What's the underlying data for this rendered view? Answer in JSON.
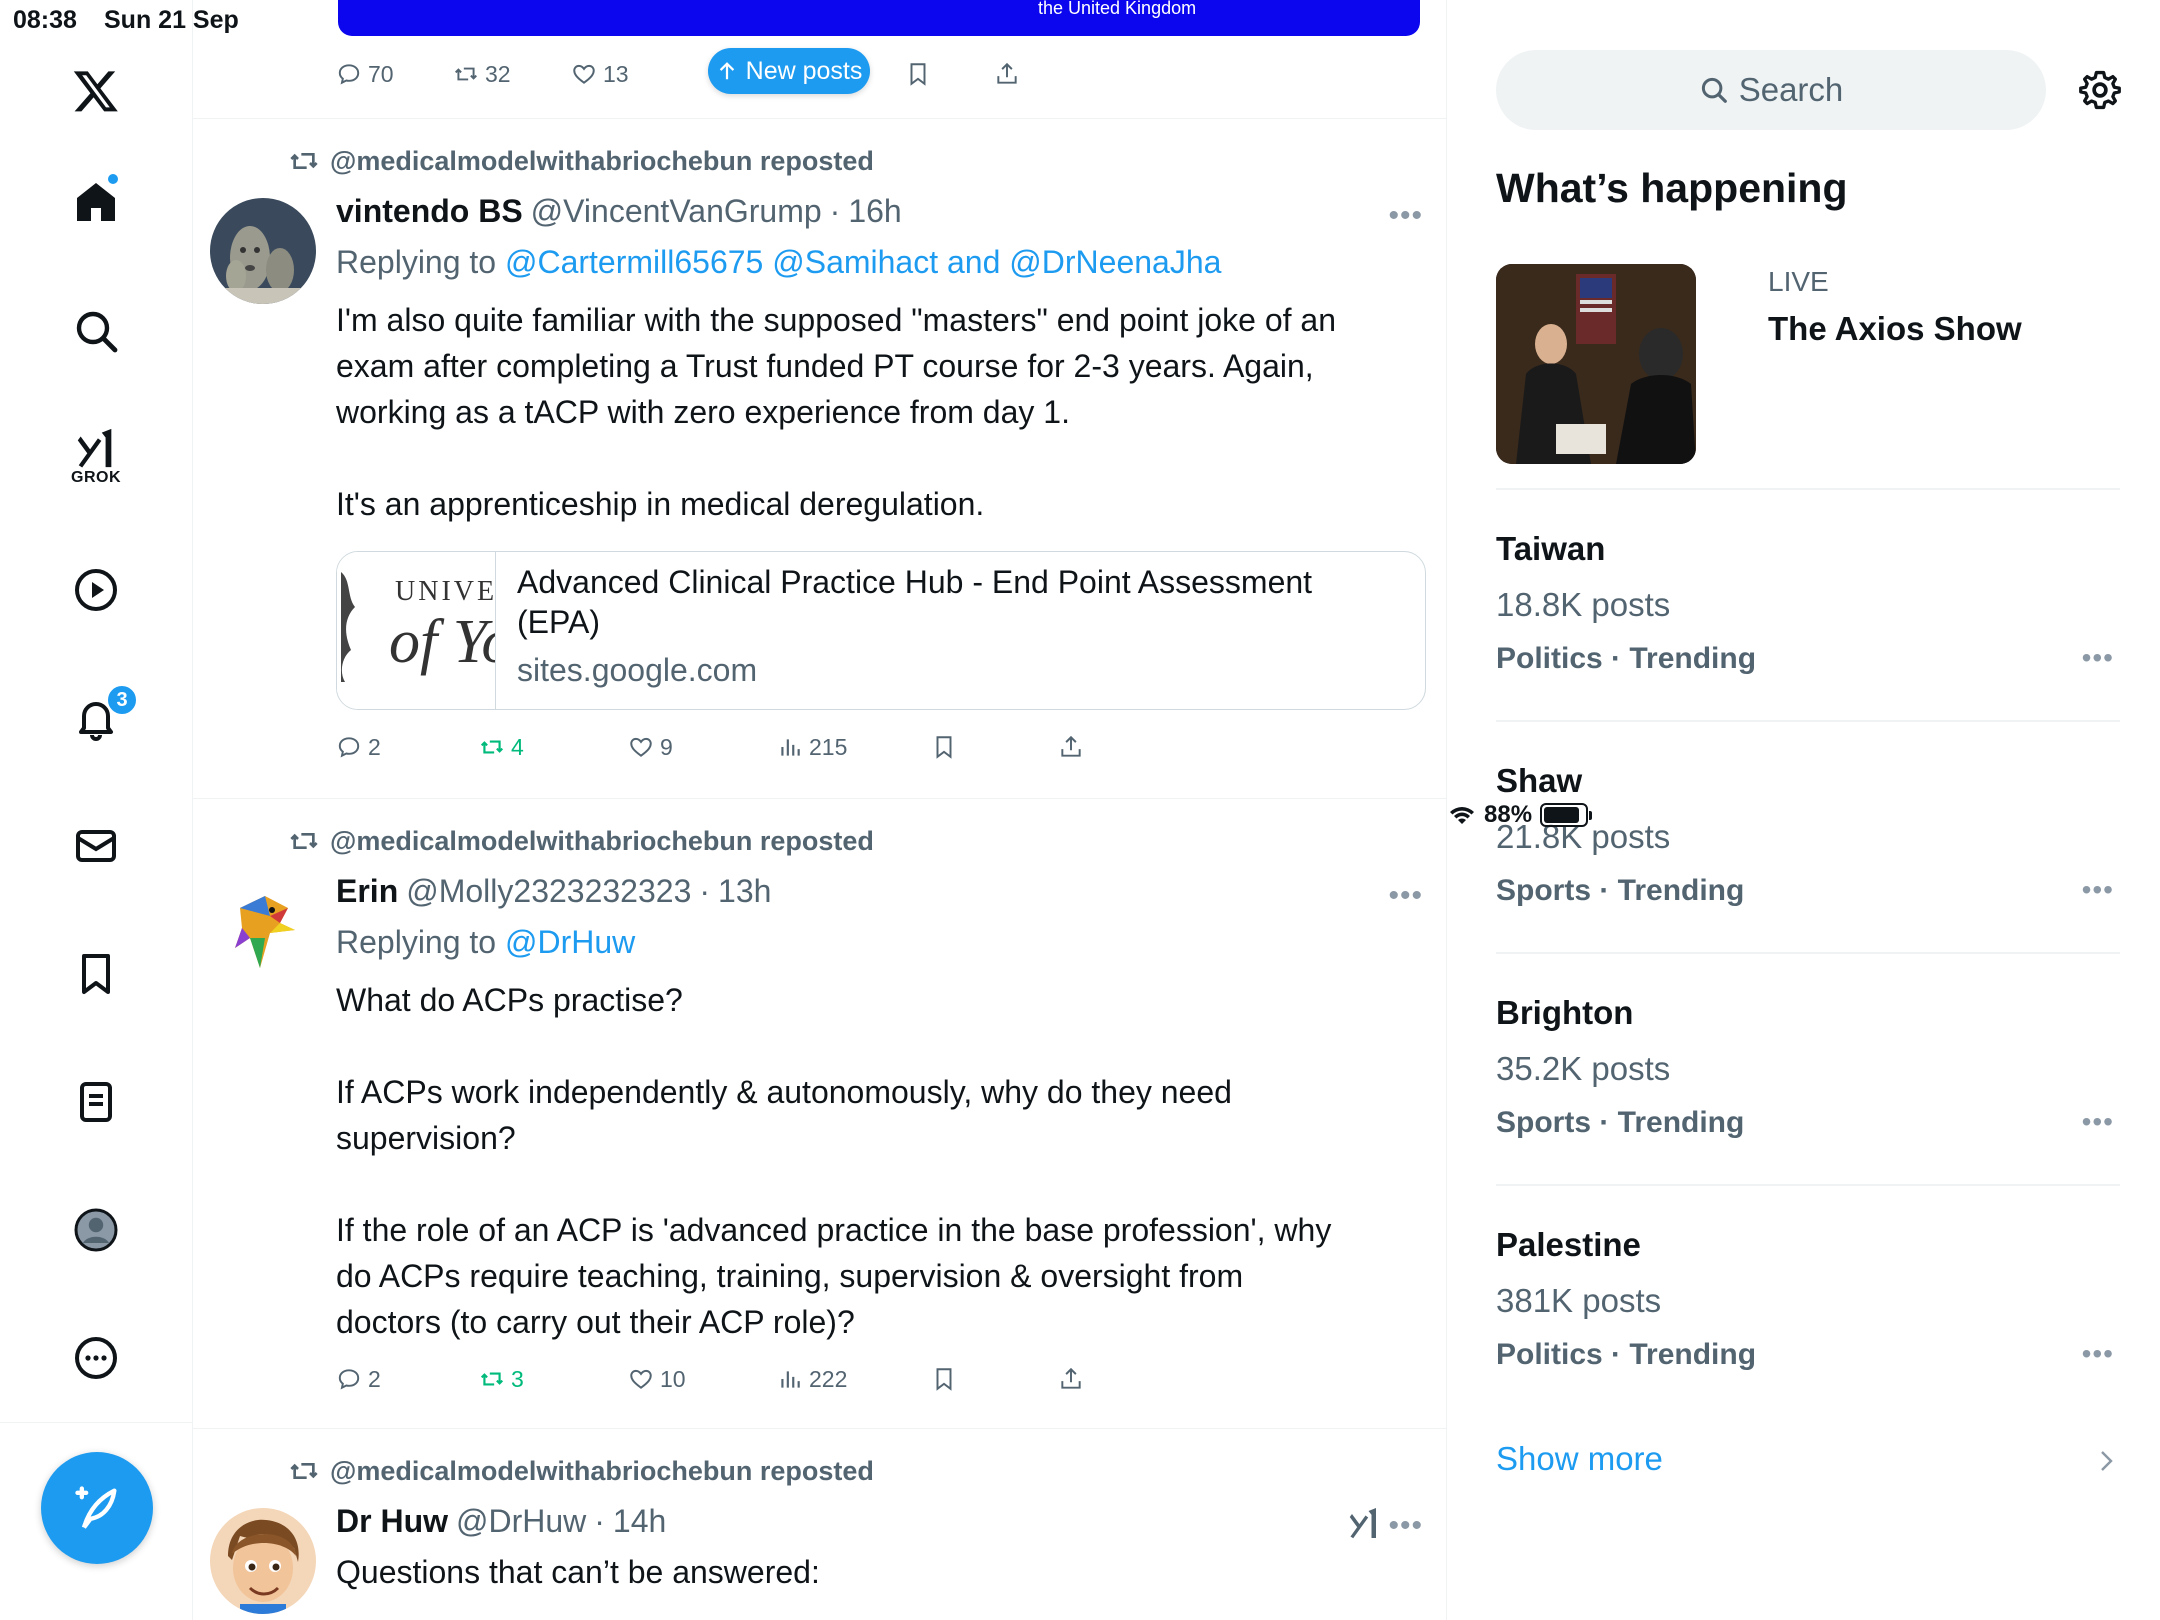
{
  "status": {
    "time": "08:38",
    "date": "Sun 21 Sep",
    "battery": "88%",
    "battery_level": 0.88
  },
  "nav": {
    "grok_label": "GROK",
    "notifications_count": "3"
  },
  "top_banner": {
    "text": "the United Kingdom"
  },
  "top_actions": {
    "replies": "70",
    "reposts": "32",
    "likes": "13",
    "views": ""
  },
  "new_posts": {
    "label": "New posts"
  },
  "posts": [
    {
      "reposted_by": "@medicalmodelwithabriochebun reposted",
      "name": "vintendo BS",
      "handle": "@VincentVanGrump",
      "time": "16h",
      "reply_prefix": "Replying to",
      "reply_to": "@Cartermill65675 @Samihact and @DrNeenaJha",
      "paragraphs": [
        "I'm also quite familiar with the supposed \"masters\" end point joke of an exam after completing a Trust funded PT course for 2-3 years. Again, working as a tACP with zero experience from day 1.",
        "It's an apprenticeship in medical deregulation."
      ],
      "card": {
        "logo_text_1": "UNIVER",
        "logo_text_2": "of Yo",
        "title": "Advanced Clinical Practice Hub - End Point Assessment (EPA)",
        "domain": "sites.google.com"
      },
      "replies": "2",
      "reposts": "4",
      "likes": "9",
      "views": "215"
    },
    {
      "reposted_by": "@medicalmodelwithabriochebun reposted",
      "name": "Erin",
      "handle": "@Molly2323232323",
      "time": "13h",
      "reply_prefix": "Replying to",
      "reply_to": "@DrHuw",
      "paragraphs": [
        "What do ACPs practise?",
        "If ACPs work independently & autonomously, why do they need supervision?",
        "If the role of an ACP is 'advanced practice in the base profession', why do ACPs require teaching, training, supervision & oversight from doctors (to carry out their ACP role)?"
      ],
      "replies": "2",
      "reposts": "3",
      "likes": "10",
      "views": "222"
    },
    {
      "reposted_by": "@medicalmodelwithabriochebun reposted",
      "name": "Dr Huw",
      "handle": "@DrHuw",
      "time": "14h",
      "paragraphs": [
        "Questions that can’t be answered:"
      ]
    }
  ],
  "sidebar": {
    "search_placeholder": "Search",
    "heading": "What’s happening",
    "live": {
      "label": "LIVE",
      "title": "The Axios Show"
    },
    "trends": [
      {
        "name": "Taiwan",
        "count": "18.8K posts",
        "category": "Politics · Trending"
      },
      {
        "name": "Shaw",
        "count": "21.8K posts",
        "category": "Sports · Trending"
      },
      {
        "name": "Brighton",
        "count": "35.2K posts",
        "category": "Sports · Trending"
      },
      {
        "name": "Palestine",
        "count": "381K posts",
        "category": "Politics · Trending"
      }
    ],
    "show_more": "Show more"
  },
  "colors": {
    "accent": "#1d9bf0",
    "text": "#0f1419",
    "muted": "#536471",
    "repost_green": "#00ba7c",
    "banner_blue": "#0b06ee"
  },
  "icons": [
    "x-logo-icon",
    "home-icon",
    "search-icon",
    "grok-icon",
    "video-icon",
    "bell-icon",
    "mail-icon",
    "bookmark-icon",
    "list-icon",
    "profile-icon",
    "more-icon",
    "compose-icon",
    "reply-icon",
    "repost-icon",
    "like-icon",
    "views-icon",
    "share-icon",
    "gear-icon",
    "chevron-right-icon"
  ]
}
